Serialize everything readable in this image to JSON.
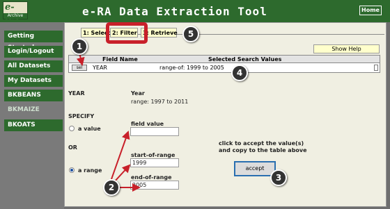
{
  "logo": {
    "text": "e-RA",
    "tag": "Archive"
  },
  "app_title": "e-RA Data Extraction Tool",
  "home_label": "Home",
  "sidebar": {
    "items": [
      {
        "label": "Getting Started"
      },
      {
        "label": "Login/Logout"
      },
      {
        "label": "All Datasets"
      },
      {
        "label": "My Datasets"
      },
      {
        "label": "BKBEANS"
      },
      {
        "label": "BKMAIZE"
      },
      {
        "label": "BKOATS"
      }
    ]
  },
  "tabs": [
    "1: Select",
    "2: Filter",
    "3: Retrieve"
  ],
  "show_help": "Show Help",
  "table": {
    "headers": [
      "Field Name",
      "Selected Search Values"
    ],
    "row": {
      "select_label": "sel",
      "field": "YEAR",
      "values": "range-of: 1999 to 2005"
    }
  },
  "filter": {
    "field_header": "YEAR",
    "desc_header": "Year",
    "range_text": "range: 1997 to 2011",
    "specify_label": "SPECIFY",
    "or_label": "OR",
    "a_value_label": "a value",
    "a_range_label": "a range",
    "field_value_label": "field value",
    "field_value": "",
    "start_label": "start-of-range",
    "start_value": "1999",
    "end_label": "end-of-range",
    "end_value": "2005",
    "accept_note_1": "click to accept the value(s)",
    "accept_note_2": "and copy to the table above",
    "accept_label": "accept",
    "selected_mode": "a range"
  },
  "callouts": [
    "1",
    "2",
    "3",
    "4",
    "5"
  ],
  "colors": {
    "header_green": "#2d6a2d",
    "tab_yellow": "#ffffcc",
    "highlight_red": "#c8202a",
    "panel_bg": "#f0efe2"
  }
}
